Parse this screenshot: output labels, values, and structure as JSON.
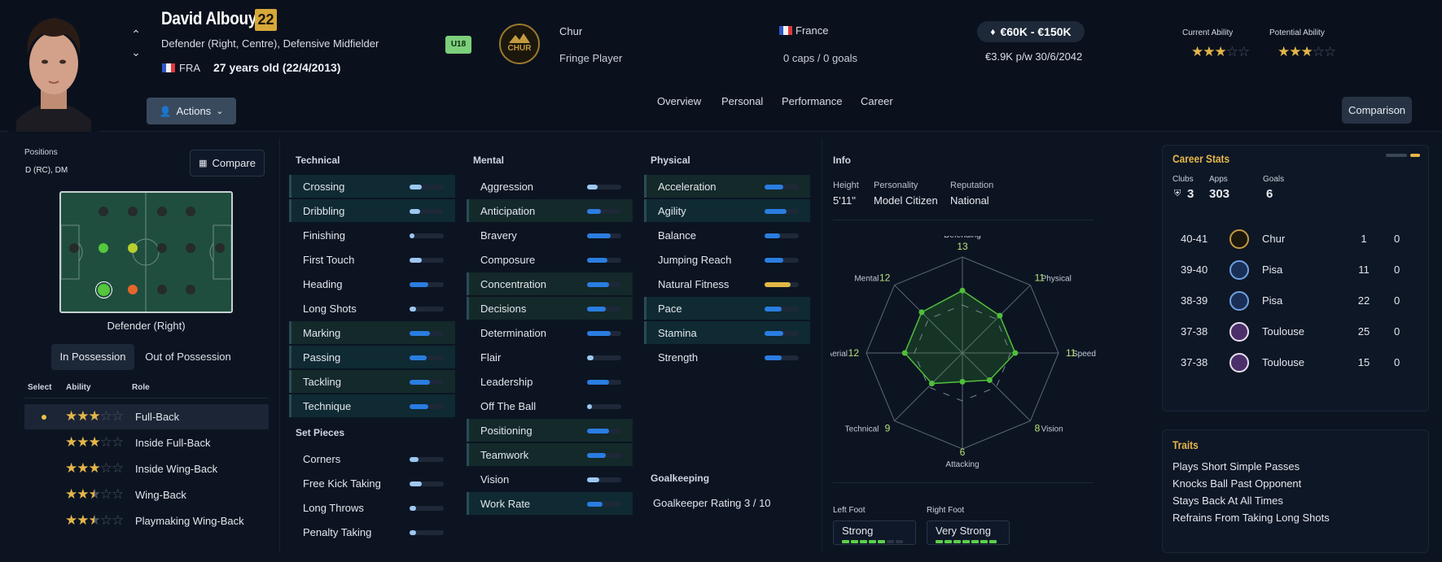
{
  "player": {
    "name": "David Albouy",
    "rating_badge": "22",
    "positions": "Defender (Right, Centre), Defensive Midfielder",
    "nation_code": "FRA",
    "age_text": "27 years old (22/4/2013)",
    "u18": "U18",
    "club": "Chur",
    "squad_status": "Fringe Player",
    "country": "France",
    "caps": "0 caps / 0 goals",
    "value": "€60K - €150K",
    "wage_contract": "€3.9K p/w 30/6/2042",
    "current_ability_label": "Current Ability",
    "potential_ability_label": "Potential Ability",
    "current_ability_stars": 3,
    "potential_ability_stars": 3
  },
  "actions_label": "Actions",
  "nav_tabs": [
    "Overview",
    "Personal",
    "Performance",
    "Career"
  ],
  "comparison_label": "Comparison",
  "left": {
    "positions_label": "Positions",
    "positions_value": "D (RC), DM",
    "compare_label": "Compare",
    "pitch_caption": "Defender (Right)",
    "tab_in": "In Possession",
    "tab_out": "Out of Possession",
    "headers": [
      "Select",
      "Ability",
      "Role"
    ],
    "roles": [
      {
        "name": "Full-Back",
        "stars": 3,
        "selected": true
      },
      {
        "name": "Inside Full-Back",
        "stars": 3,
        "selected": false
      },
      {
        "name": "Inside Wing-Back",
        "stars": 3,
        "selected": false
      },
      {
        "name": "Wing-Back",
        "stars": 2.5,
        "selected": false
      },
      {
        "name": "Playmaking Wing-Back",
        "stars": 2.5,
        "selected": false
      }
    ]
  },
  "technical": {
    "title": "Technical",
    "items": [
      {
        "name": "Crossing",
        "v": 0.35,
        "hl": "b"
      },
      {
        "name": "Dribbling",
        "v": 0.3,
        "hl": "b"
      },
      {
        "name": "Finishing",
        "v": 0.15,
        "hl": ""
      },
      {
        "name": "First Touch",
        "v": 0.35,
        "hl": ""
      },
      {
        "name": "Heading",
        "v": 0.55,
        "hl": ""
      },
      {
        "name": "Long Shots",
        "v": 0.2,
        "hl": ""
      },
      {
        "name": "Marking",
        "v": 0.6,
        "hl": "g"
      },
      {
        "name": "Passing",
        "v": 0.5,
        "hl": "b"
      },
      {
        "name": "Tackling",
        "v": 0.6,
        "hl": "g"
      },
      {
        "name": "Technique",
        "v": 0.55,
        "hl": "b"
      }
    ]
  },
  "set_pieces": {
    "title": "Set Pieces",
    "items": [
      {
        "name": "Corners",
        "v": 0.25,
        "hl": ""
      },
      {
        "name": "Free Kick Taking",
        "v": 0.35,
        "hl": ""
      },
      {
        "name": "Long Throws",
        "v": 0.2,
        "hl": ""
      },
      {
        "name": "Penalty Taking",
        "v": 0.2,
        "hl": ""
      }
    ]
  },
  "mental": {
    "title": "Mental",
    "items": [
      {
        "name": "Aggression",
        "v": 0.3,
        "hl": ""
      },
      {
        "name": "Anticipation",
        "v": 0.4,
        "hl": "g"
      },
      {
        "name": "Bravery",
        "v": 0.7,
        "hl": ""
      },
      {
        "name": "Composure",
        "v": 0.6,
        "hl": ""
      },
      {
        "name": "Concentration",
        "v": 0.65,
        "hl": "g"
      },
      {
        "name": "Decisions",
        "v": 0.55,
        "hl": "g"
      },
      {
        "name": "Determination",
        "v": 0.7,
        "hl": ""
      },
      {
        "name": "Flair",
        "v": 0.2,
        "hl": ""
      },
      {
        "name": "Leadership",
        "v": 0.65,
        "hl": ""
      },
      {
        "name": "Off The Ball",
        "v": 0.08,
        "hl": ""
      },
      {
        "name": "Positioning",
        "v": 0.65,
        "hl": "g"
      },
      {
        "name": "Teamwork",
        "v": 0.55,
        "hl": "g"
      },
      {
        "name": "Vision",
        "v": 0.35,
        "hl": ""
      },
      {
        "name": "Work Rate",
        "v": 0.45,
        "hl": "b"
      }
    ]
  },
  "physical": {
    "title": "Physical",
    "items": [
      {
        "name": "Acceleration",
        "v": 0.55,
        "hl": "g"
      },
      {
        "name": "Agility",
        "v": 0.65,
        "hl": "b"
      },
      {
        "name": "Balance",
        "v": 0.45,
        "hl": ""
      },
      {
        "name": "Jumping Reach",
        "v": 0.55,
        "hl": ""
      },
      {
        "name": "Natural Fitness",
        "v": 0.75,
        "hl": "",
        "gold": true
      },
      {
        "name": "Pace",
        "v": 0.5,
        "hl": "b"
      },
      {
        "name": "Stamina",
        "v": 0.55,
        "hl": "b"
      },
      {
        "name": "Strength",
        "v": 0.5,
        "hl": ""
      }
    ]
  },
  "goalkeeping": {
    "title": "Goalkeeping",
    "rating": "Goalkeeper Rating 3 / 10"
  },
  "info": {
    "title": "Info",
    "height_label": "Height",
    "height": "5'11\"",
    "personality_label": "Personality",
    "personality": "Model Citizen",
    "reputation_label": "Reputation",
    "reputation": "National",
    "left_foot_label": "Left Foot",
    "left_foot": "Strong",
    "left_foot_level": 5,
    "right_foot_label": "Right Foot",
    "right_foot": "Very Strong",
    "right_foot_level": 7
  },
  "radar": {
    "axes": [
      {
        "label": "Defending",
        "value": "13",
        "v": 13
      },
      {
        "label": "Physical",
        "value": "11",
        "v": 11
      },
      {
        "label": "Speed",
        "value": "11",
        "v": 11
      },
      {
        "label": "Vision",
        "value": "8",
        "v": 8
      },
      {
        "label": "Attacking",
        "value": "6",
        "v": 6
      },
      {
        "label": "Technical",
        "value": "9",
        "v": 9
      },
      {
        "label": "Aerial",
        "value": "12",
        "v": 12
      },
      {
        "label": "Mental",
        "value": "12",
        "v": 12
      }
    ]
  },
  "career": {
    "title": "Career Stats",
    "clubs_label": "Clubs",
    "clubs": "3",
    "apps_label": "Apps",
    "apps": "303",
    "goals_label": "Goals",
    "goals": "6",
    "rows": [
      {
        "season": "40-41",
        "club": "Chur",
        "apps": "1",
        "goals": "0"
      },
      {
        "season": "39-40",
        "club": "Pisa",
        "apps": "11",
        "goals": "0"
      },
      {
        "season": "38-39",
        "club": "Pisa",
        "apps": "22",
        "goals": "0"
      },
      {
        "season": "37-38",
        "club": "Toulouse",
        "apps": "25",
        "goals": "0"
      },
      {
        "season": "37-38",
        "club": "Toulouse",
        "apps": "15",
        "goals": "0"
      }
    ]
  },
  "traits": {
    "title": "Traits",
    "items": [
      "Plays Short Simple Passes",
      "Knocks Ball Past Opponent",
      "Stays Back At All Times",
      "Refrains From Taking Long Shots"
    ]
  },
  "colors": {
    "accent": "#d7a83a",
    "bar": "#2a7de1",
    "bar_light": "#9cc8f2",
    "gold": "#e1b846",
    "green": "#5bd04a"
  }
}
